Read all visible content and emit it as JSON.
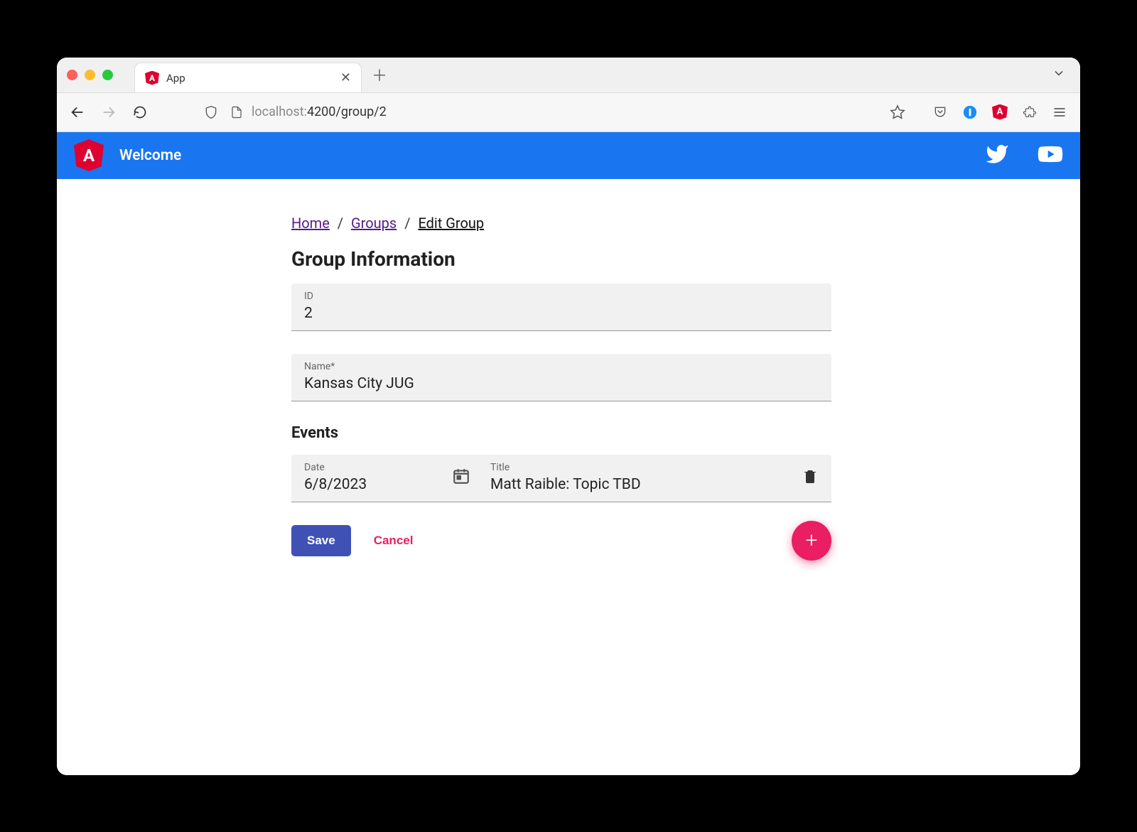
{
  "browser": {
    "tab_title": "App",
    "url_host": "localhost:",
    "url_path": "4200/group/2"
  },
  "header": {
    "title": "Welcome"
  },
  "breadcrumb": {
    "home": "Home",
    "groups": "Groups",
    "current": "Edit Group"
  },
  "page": {
    "title": "Group Information",
    "events_title": "Events"
  },
  "fields": {
    "id_label": "ID",
    "id_value": "2",
    "name_label": "Name*",
    "name_value": "Kansas City JUG"
  },
  "events": [
    {
      "date_label": "Date",
      "date_value": "6/8/2023",
      "title_label": "Title",
      "title_value": "Matt Raible: Topic TBD"
    }
  ],
  "actions": {
    "save": "Save",
    "cancel": "Cancel"
  }
}
